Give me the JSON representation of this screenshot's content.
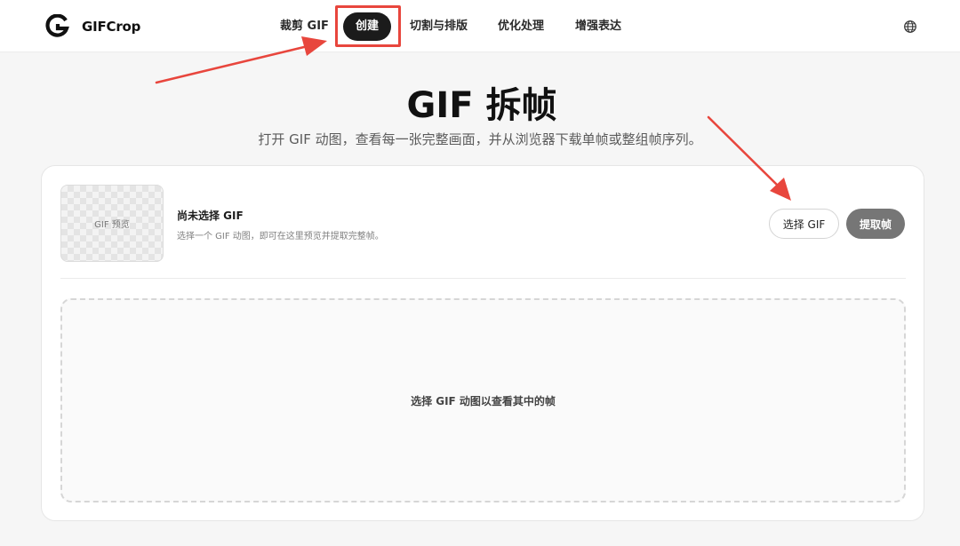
{
  "brand": {
    "name": "GIFCrop"
  },
  "nav": {
    "items": [
      {
        "label": "裁剪 GIF",
        "active": false
      },
      {
        "label": "创建",
        "active": true
      },
      {
        "label": "切割与排版",
        "active": false
      },
      {
        "label": "优化处理",
        "active": false
      },
      {
        "label": "增强表达",
        "active": false
      }
    ]
  },
  "hero": {
    "title": "GIF 拆帧",
    "subtitle": "打开 GIF 动图，查看每一张完整画面，并从浏览器下载单帧或整组帧序列。"
  },
  "card": {
    "preview_label": "GIF 预览",
    "file_title": "尚未选择 GIF",
    "file_desc": "选择一个 GIF 动图，即可在这里预览并提取完整帧。",
    "select_button": "选择 GIF",
    "extract_button": "提取帧",
    "dropzone_text": "选择 GIF 动图以查看其中的帧"
  },
  "colors": {
    "accent": "#1b1b1b",
    "annotation": "#e8463d",
    "disabled_button": "#767676"
  },
  "icons": [
    "gifcrop-logo-icon",
    "globe-icon"
  ]
}
